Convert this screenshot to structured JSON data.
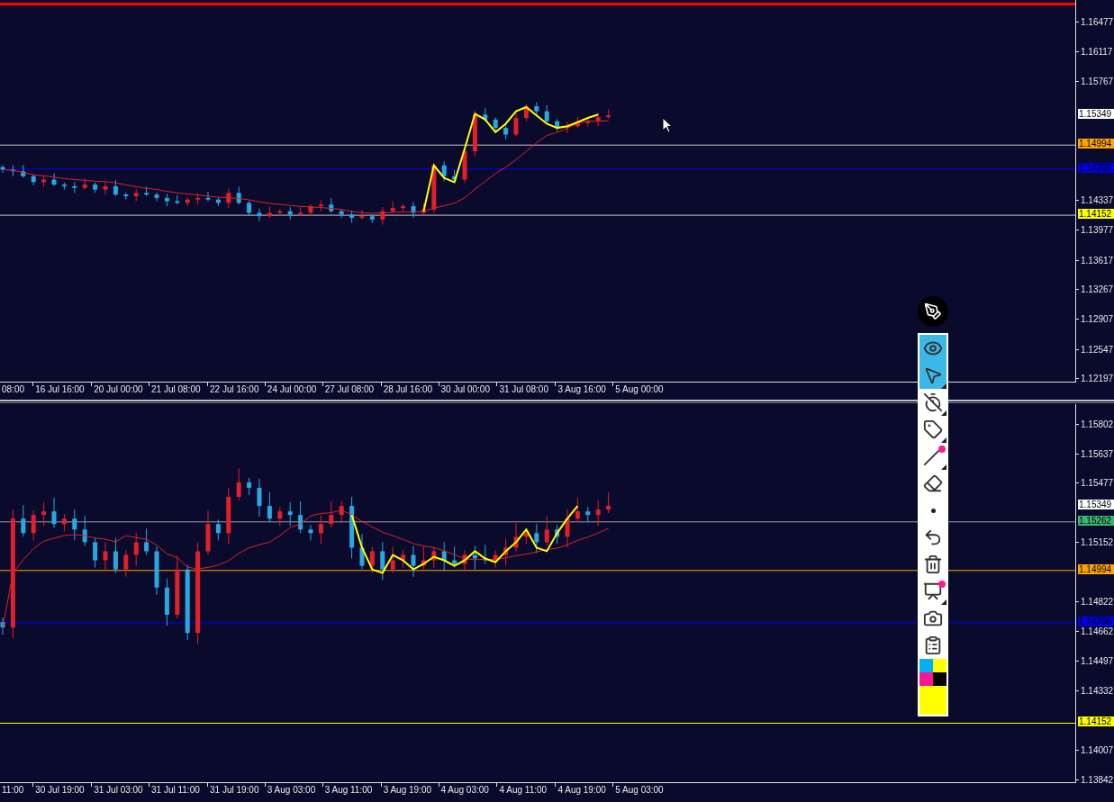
{
  "panels": [
    {
      "alert_line": {
        "color": "#ff0000"
      },
      "price_axis": [
        "1.16477",
        "1.16117",
        "1.15767",
        "1.14337",
        "1.13977",
        "1.13617",
        "1.13267",
        "1.12907",
        "1.12547",
        "1.12197"
      ],
      "time_axis": [
        "08:00",
        "16 Jul 16:00",
        "20 Jul 00:00",
        "21 Jul 08:00",
        "22 Jul 16:00",
        "24 Jul 00:00",
        "27 Jul 08:00",
        "28 Jul 16:00",
        "30 Jul 00:00",
        "31 Jul 08:00",
        "3 Aug 16:00",
        "5 Aug 00:00"
      ],
      "price_labels": [
        {
          "text": "1.15349",
          "color": "#ffffff"
        },
        {
          "text": "1.14994",
          "color": "#ffa500"
        },
        {
          "text": "1.14706",
          "color": "#0000e0"
        },
        {
          "text": "1.14152",
          "color": "#ffff00"
        }
      ]
    },
    {
      "price_axis": [
        "1.15802",
        "1.15637",
        "1.15477",
        "1.15152",
        "1.14822",
        "1.14662",
        "1.14497",
        "1.14332",
        "1.14007",
        "1.13842"
      ],
      "time_axis": [
        "11:00",
        "30 Jul 19:00",
        "31 Jul 03:00",
        "31 Jul 11:00",
        "31 Jul 19:00",
        "3 Aug 03:00",
        "3 Aug 11:00",
        "3 Aug 19:00",
        "4 Aug 03:00",
        "4 Aug 11:00",
        "4 Aug 19:00",
        "5 Aug 03:00"
      ],
      "price_labels": [
        {
          "text": "1.15349",
          "color": "#ffffff"
        },
        {
          "text": "1.15262",
          "color": "#3cb371"
        },
        {
          "text": "1.14994",
          "color": "#ffa500"
        },
        {
          "text": "1.14706",
          "color": "#0000e0"
        },
        {
          "text": "1.14152",
          "color": "#ffff00"
        }
      ]
    }
  ],
  "toolbar": {
    "tools": [
      {
        "kind": "eye",
        "selected": true,
        "has_menu": false,
        "badge": false
      },
      {
        "kind": "cursor",
        "selected": true,
        "has_menu": true,
        "badge": false
      },
      {
        "kind": "timer-off",
        "selected": false,
        "has_menu": true,
        "badge": false
      },
      {
        "kind": "label",
        "selected": false,
        "has_menu": true,
        "badge": false
      },
      {
        "kind": "line",
        "selected": false,
        "has_menu": true,
        "badge": true
      },
      {
        "kind": "eraser",
        "selected": false,
        "has_menu": false,
        "badge": false
      },
      {
        "kind": "dot",
        "selected": false,
        "has_menu": false,
        "badge": false
      },
      {
        "kind": "undo",
        "selected": false,
        "has_menu": false,
        "badge": false
      },
      {
        "kind": "trash",
        "selected": false,
        "has_menu": false,
        "badge": false
      },
      {
        "kind": "easel",
        "selected": false,
        "has_menu": true,
        "badge": true
      },
      {
        "kind": "camera",
        "selected": false,
        "has_menu": false,
        "badge": false
      },
      {
        "kind": "clipboard",
        "selected": false,
        "has_menu": false,
        "badge": false
      }
    ],
    "swatches": [
      {
        "color": "#00b0f0"
      },
      {
        "color": "#ffff00"
      },
      {
        "color": "#ff1493"
      },
      {
        "color": "#000000"
      }
    ],
    "current_color": {
      "color": "#ffff00"
    }
  }
}
